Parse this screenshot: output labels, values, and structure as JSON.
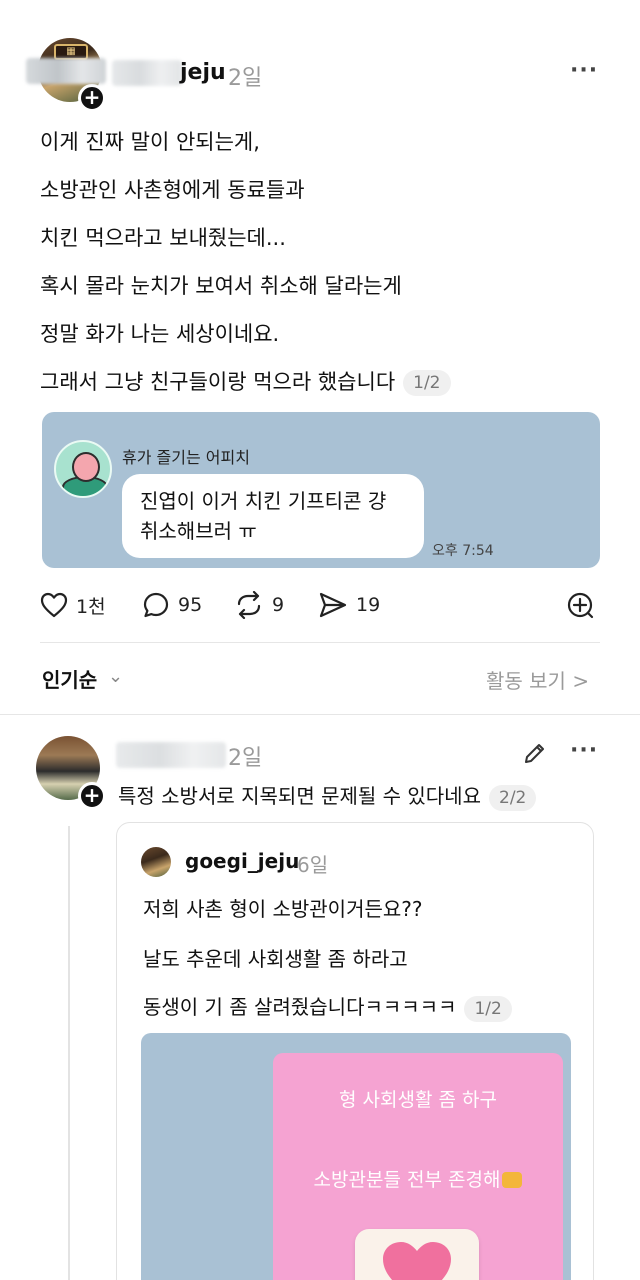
{
  "post": {
    "username": "jeju",
    "time": "2일",
    "more": "···",
    "lines": [
      "이게 진짜 말이 안되는게,",
      "소방관인 사촌형에게 동료들과",
      "치킨 먹으라고 보내줬는데...",
      "혹시 몰라 눈치가 보여서 취소해 달라는게",
      "정말 화가 나는 세상이네요.",
      "그래서 그냥 친구들이랑 먹으라 했습니다"
    ],
    "pager": "1/2",
    "image": {
      "sender": "휴가 즐기는 어피치",
      "bubble_line1": "진엽이 이거 치킨 기프티콘 걍",
      "bubble_line2": "취소해브러 ㅠ",
      "time": "오후 7:54"
    },
    "actions": {
      "likes": "1천",
      "comments": "95",
      "reposts": "9",
      "shares": "19"
    }
  },
  "sort": {
    "label": "인기순",
    "activity": "활동 보기 >"
  },
  "reply": {
    "time": "2일",
    "text": "특정 소방서로 지목되면 문제될 수 있다네요",
    "pager": "2/2",
    "quote": {
      "username": "goegi_jeju",
      "time": "6일",
      "lines": [
        "저희 사촌 형이 소방관이거든요??",
        "날도 추운데 사회생활 좀 하라고",
        "동생이 기 좀 살려줬습니다ㅋㅋㅋㅋㅋ"
      ],
      "pager": "1/2",
      "image_text_1": "형 사회생활 좀 하구",
      "image_text_2": "소방관분들 전부 존경해"
    }
  },
  "colors": {
    "image_bg": "#a9c1d4",
    "pink_card": "#f5a3d2"
  }
}
